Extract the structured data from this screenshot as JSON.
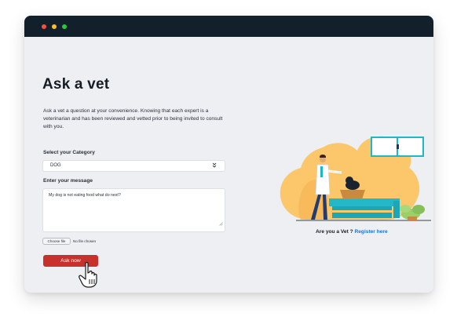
{
  "window": {
    "controls": [
      "close",
      "minimize",
      "maximize"
    ]
  },
  "page": {
    "title": "Ask a vet",
    "intro": "Ask a vet a question at your convenience. Knowing that each expert is a veterinarian and has been reviewed and vetted prior to being invited to consult with you."
  },
  "form": {
    "category_label": "Select your Category",
    "category_value": "DOG",
    "message_label": "Enter your message",
    "message_value": "My dog is not eating food what do next?",
    "file_button_label": "Choose file",
    "file_status": "No file chosen",
    "submit_label": "Ask now"
  },
  "cta": {
    "question": "Are you a Vet ?",
    "link": "Register here"
  },
  "colors": {
    "titlebar": "#11202a",
    "accent_button": "#c8302c",
    "link": "#1d74c9",
    "illustration_orange": "#fcc66b",
    "illustration_teal": "#1fb6c6"
  }
}
